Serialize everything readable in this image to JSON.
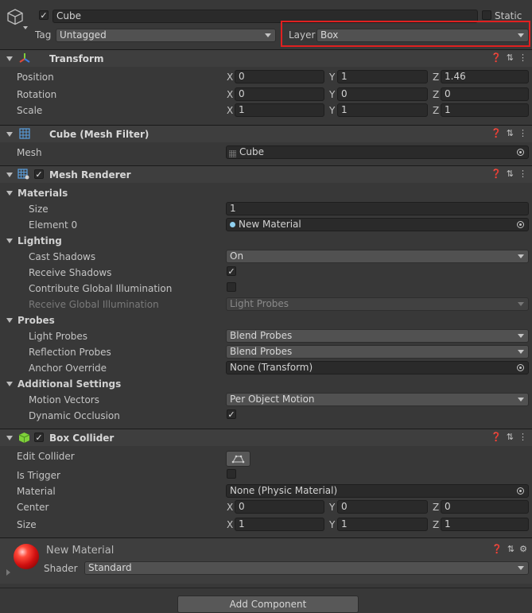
{
  "object": {
    "name": "Cube",
    "static_label": "Static",
    "tag_label": "Tag",
    "tag_value": "Untagged",
    "layer_label": "Layer",
    "layer_value": "Box"
  },
  "transform": {
    "title": "Transform",
    "position": {
      "label": "Position",
      "x": "0",
      "y": "1",
      "z": "1.46"
    },
    "rotation": {
      "label": "Rotation",
      "x": "0",
      "y": "0",
      "z": "0"
    },
    "scale": {
      "label": "Scale",
      "x": "1",
      "y": "1",
      "z": "1"
    }
  },
  "axes": {
    "x": "X",
    "y": "Y",
    "z": "Z"
  },
  "mesh_filter": {
    "title": "Cube (Mesh Filter)",
    "mesh_label": "Mesh",
    "mesh_value": "Cube"
  },
  "mesh_renderer": {
    "title": "Mesh Renderer",
    "materials": "Materials",
    "size_label": "Size",
    "size_value": "1",
    "element0_label": "Element 0",
    "element0_value": "New Material",
    "lighting": "Lighting",
    "cast_shadows_label": "Cast Shadows",
    "cast_shadows_value": "On",
    "receive_shadows_label": "Receive Shadows",
    "contribute_gi_label": "Contribute Global Illumination",
    "receive_gi_label": "Receive Global Illumination",
    "receive_gi_value": "Light Probes",
    "probes": "Probes",
    "light_probes_label": "Light Probes",
    "light_probes_value": "Blend Probes",
    "reflection_probes_label": "Reflection Probes",
    "reflection_probes_value": "Blend Probes",
    "anchor_override_label": "Anchor Override",
    "anchor_override_value": "None (Transform)",
    "additional": "Additional Settings",
    "motion_vectors_label": "Motion Vectors",
    "motion_vectors_value": "Per Object Motion",
    "dynamic_occlusion_label": "Dynamic Occlusion"
  },
  "box_collider": {
    "title": "Box Collider",
    "edit_collider_label": "Edit Collider",
    "is_trigger_label": "Is Trigger",
    "material_label": "Material",
    "material_value": "None (Physic Material)",
    "center": {
      "label": "Center",
      "x": "0",
      "y": "0",
      "z": "0"
    },
    "size": {
      "label": "Size",
      "x": "1",
      "y": "1",
      "z": "1"
    }
  },
  "material": {
    "name": "New Material",
    "shader_label": "Shader",
    "shader_value": "Standard"
  },
  "add_component": "Add Component",
  "colors": {
    "highlight_box": "#e02020",
    "background": "#383838",
    "header": "#3e3e3e"
  }
}
